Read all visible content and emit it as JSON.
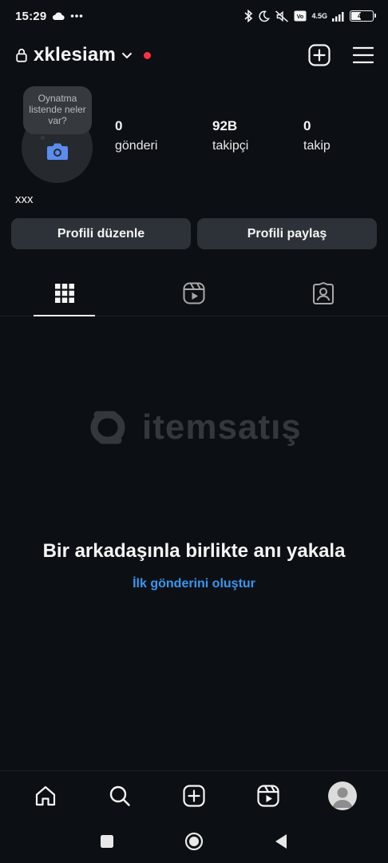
{
  "status_bar": {
    "time": "15:29",
    "network": "4.5G",
    "battery": "44"
  },
  "header": {
    "username": "xklesiam"
  },
  "profile": {
    "bubble_text": "Oynatma listende neler var?",
    "stats": [
      {
        "value": "0",
        "label": "gönderi"
      },
      {
        "value": "92B",
        "label": "takipçi"
      },
      {
        "value": "0",
        "label": "takip"
      }
    ],
    "full_name": "xxx",
    "edit_button": "Profili düzenle",
    "share_button": "Profili paylaş"
  },
  "tabs": [
    "grid",
    "reels",
    "tagged"
  ],
  "watermark": {
    "brand": "itemsatış"
  },
  "empty_state": {
    "title": "Bir arkadaşınla birlikte anı yakala",
    "action": "İlk gönderini oluştur"
  },
  "icons": {
    "lock": "lock-icon",
    "chevron": "chevron-down-icon",
    "new_post": "plus-square-icon",
    "menu": "hamburger-menu-icon",
    "camera": "camera-icon"
  },
  "colors": {
    "background": "#0c1014",
    "link": "#3897f0",
    "button": "#2d3238",
    "notification": "#ff3040",
    "camera": "#5b8def"
  }
}
